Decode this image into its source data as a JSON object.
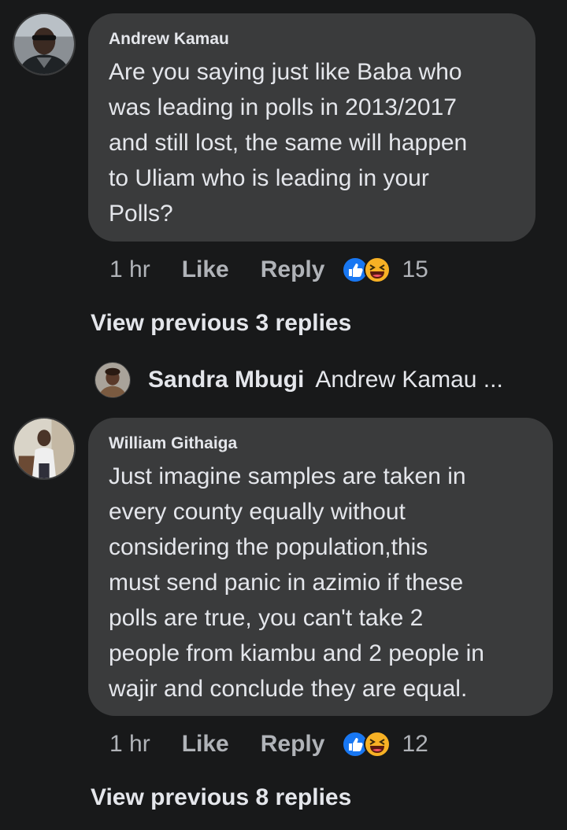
{
  "comments": [
    {
      "author": "Andrew Kamau",
      "avatar": "avatar-andrew",
      "text": "Are you saying just like Baba who\nwas leading in polls in 2013/2017\nand still lost, the same will happen\nto Uliam who is leading in your\nPolls?",
      "time": "1 hr",
      "like_label": "Like",
      "reply_label": "Reply",
      "reaction_count": "15",
      "view_previous": "View previous 3 replies",
      "latest_reply": {
        "author": "Sandra Mbugi",
        "snippet": "Andrew Kamau ..."
      }
    },
    {
      "author": "William Githaiga",
      "avatar": "avatar-william",
      "text": "Just imagine samples are taken in\nevery county equally without\nconsidering the population,this\nmust send  panic in azimio if these\npolls are true, you can't take 2\npeople from kiambu and 2 people in\nwajir and conclude they are equal.",
      "time": "1 hr",
      "like_label": "Like",
      "reply_label": "Reply",
      "reaction_count": "12",
      "view_previous": "View previous 8 replies"
    }
  ],
  "colors": {
    "background": "#18191a",
    "bubble": "#3a3b3c",
    "text_primary": "#e4e6eb",
    "text_secondary": "#b0b3b8",
    "like_blue": "#1877f2",
    "haha_yellow": "#f7b125"
  },
  "icons": [
    "like-reaction-icon",
    "haha-reaction-icon"
  ]
}
